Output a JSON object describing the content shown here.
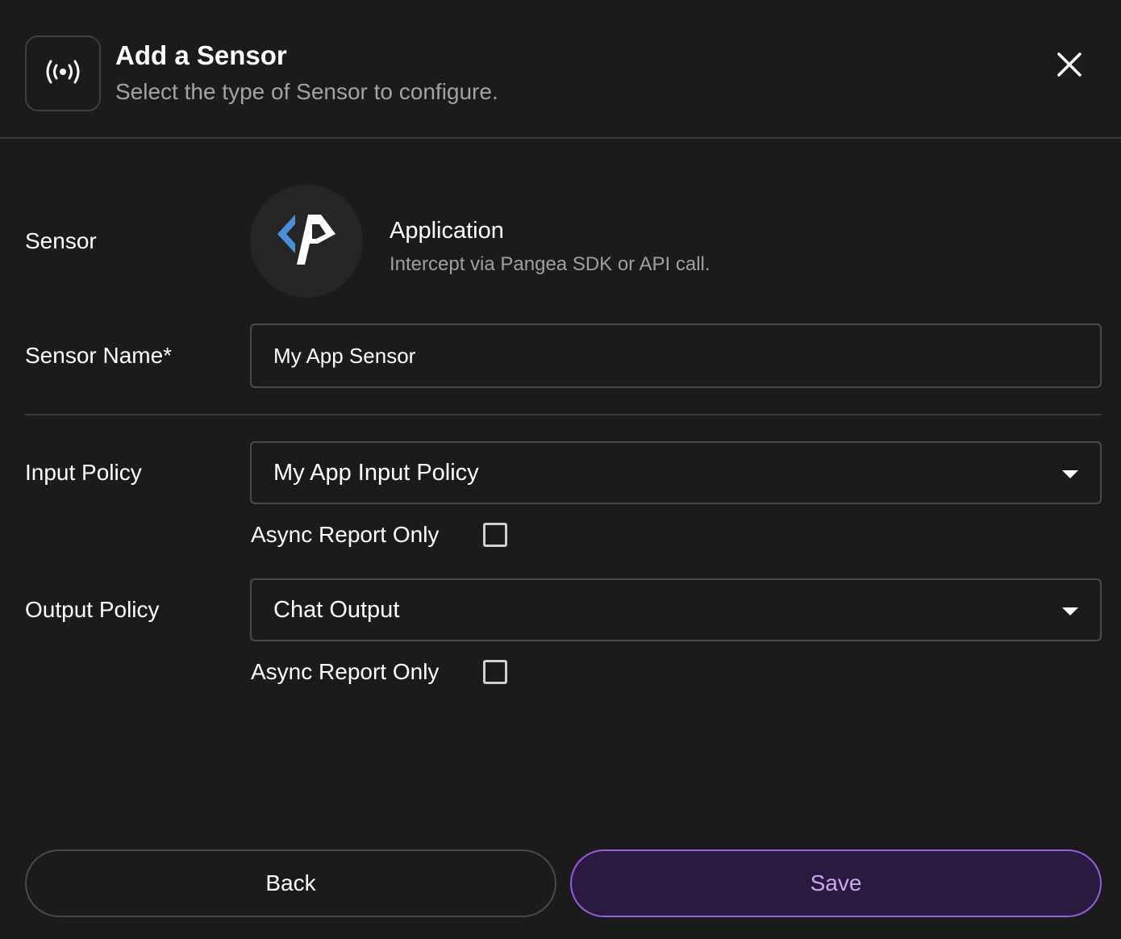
{
  "header": {
    "icon": "broadcast-icon",
    "title": "Add a Sensor",
    "subtitle": "Select the type of Sensor to configure.",
    "close_icon": "close-icon"
  },
  "sensor": {
    "label": "Sensor",
    "logo_icon": "code-brackets-icon",
    "type_name": "Application",
    "type_description": "Intercept via Pangea SDK or API call."
  },
  "sensor_name": {
    "label": "Sensor Name*",
    "value": "My App Sensor"
  },
  "input_policy": {
    "label": "Input Policy",
    "selected": "My App Input Policy",
    "async_label": "Async Report Only",
    "async_checked": false
  },
  "output_policy": {
    "label": "Output Policy",
    "selected": "Chat Output",
    "async_label": "Async Report Only",
    "async_checked": false
  },
  "actions": {
    "back_label": "Back",
    "save_label": "Save"
  },
  "colors": {
    "background": "#1b1b1b",
    "border": "#4a4a4a",
    "accent_purple": "#9a5ce0",
    "logo_blue": "#4a90d9"
  }
}
